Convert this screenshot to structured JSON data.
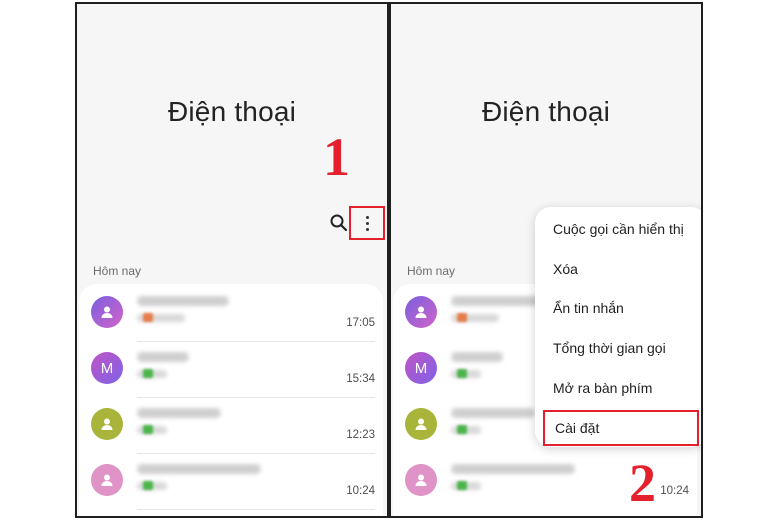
{
  "colors": {
    "accent_red": "#e3202c",
    "panel_bg": "#f6f6f6"
  },
  "left_panel": {
    "title": "Điện thoại",
    "step_number": "1",
    "icons": {
      "search": "search-icon",
      "more": "more-vertical-icon"
    },
    "section_label": "Hôm nay",
    "calls": [
      {
        "avatar_icon": "person-icon",
        "avatar_letter": "",
        "time": "17:05"
      },
      {
        "avatar_icon": "",
        "avatar_letter": "M",
        "time": "15:34"
      },
      {
        "avatar_icon": "person-icon",
        "avatar_letter": "",
        "time": "12:23"
      },
      {
        "avatar_icon": "person-icon",
        "avatar_letter": "",
        "time": "10:24"
      }
    ]
  },
  "right_panel": {
    "title": "Điện thoại",
    "step_number": "2",
    "section_label": "Hôm nay",
    "calls": [
      {
        "avatar_icon": "person-icon",
        "avatar_letter": "",
        "time": ""
      },
      {
        "avatar_icon": "",
        "avatar_letter": "M",
        "time": ""
      },
      {
        "avatar_icon": "person-icon",
        "avatar_letter": "",
        "time": ""
      },
      {
        "avatar_icon": "person-icon",
        "avatar_letter": "",
        "time": "10:24"
      }
    ],
    "menu": [
      "Cuộc gọi cần hiển thị",
      "Xóa",
      "Ẩn tin nhắn",
      "Tổng thời gian gọi",
      "Mở ra bàn phím",
      "Cài đặt"
    ],
    "highlighted_menu_item": "Cài đặt"
  }
}
